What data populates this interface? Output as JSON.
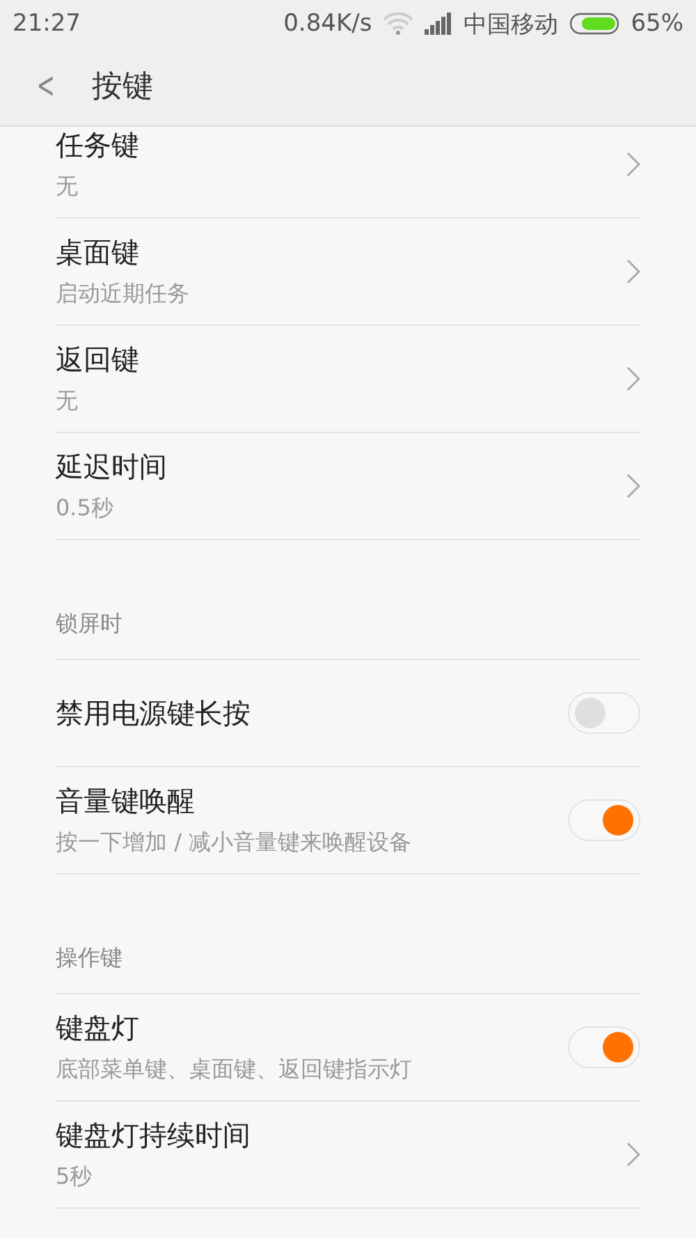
{
  "status_bar": {
    "time": "21:27",
    "speed": "0.84K/s",
    "carrier": "中国移动",
    "battery": "65%"
  },
  "header": {
    "back": "<",
    "title": "按键"
  },
  "sections": [
    {
      "items": [
        {
          "kind": "link",
          "title": "任务键",
          "subtitle": "无"
        },
        {
          "kind": "link",
          "title": "桌面键",
          "subtitle": "启动近期任务"
        },
        {
          "kind": "link",
          "title": "返回键",
          "subtitle": "无"
        },
        {
          "kind": "link",
          "title": "延迟时间",
          "subtitle": "0.5秒"
        }
      ]
    },
    {
      "header": "锁屏时",
      "items": [
        {
          "kind": "toggle",
          "title": "禁用电源键长按",
          "on": false
        },
        {
          "kind": "toggle",
          "title": "音量键唤醒",
          "subtitle": "按一下增加 / 减小音量键来唤醒设备",
          "on": true
        }
      ]
    },
    {
      "header": "操作键",
      "items": [
        {
          "kind": "toggle",
          "title": "键盘灯",
          "subtitle": "底部菜单键、桌面键、返回键指示灯",
          "on": true
        },
        {
          "kind": "link",
          "title": "键盘灯持续时间",
          "subtitle": "5秒"
        }
      ]
    }
  ]
}
